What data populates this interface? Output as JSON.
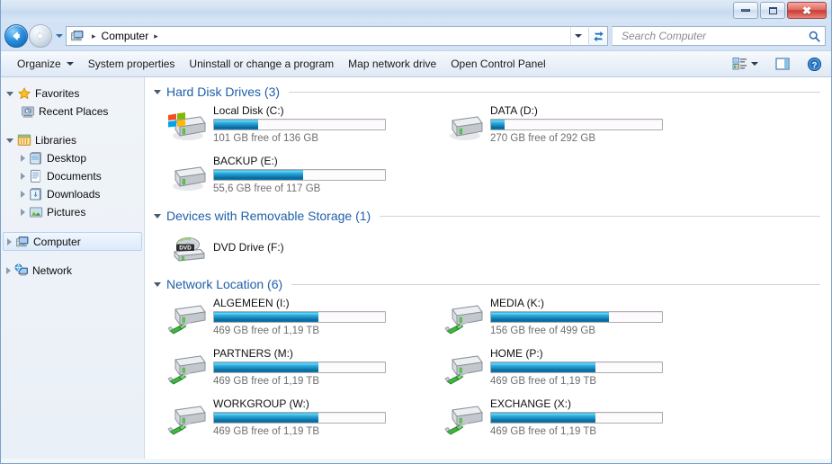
{
  "window": {
    "buttons": {
      "minimize": "Minimize",
      "maximize": "Maximize",
      "close": "✖"
    }
  },
  "navigation": {
    "back_label": "Back",
    "forward_label": "Forward",
    "history_label": "Recent pages",
    "refresh_label": "Refresh",
    "breadcrumb": {
      "icon": "computer-icon",
      "items": [
        "Computer"
      ],
      "separator": "▸"
    }
  },
  "search": {
    "placeholder": "Search Computer",
    "value": "",
    "icon": "search-icon"
  },
  "toolbar": {
    "organize": "Organize",
    "system_properties": "System properties",
    "uninstall": "Uninstall or change a program",
    "map_network_drive": "Map network drive",
    "open_control_panel": "Open Control Panel",
    "change_view_label": "Change your view",
    "preview_pane_label": "Show the preview pane",
    "help_label": "Get help",
    "help_glyph": "?"
  },
  "sidebar": {
    "groups": [
      {
        "label": "Favorites",
        "icon": "star-icon",
        "expanded": true,
        "children": [
          {
            "label": "Recent Places",
            "icon": "recent-places-icon",
            "expandable": false
          }
        ]
      },
      {
        "label": "Libraries",
        "icon": "libraries-icon",
        "expanded": true,
        "children": [
          {
            "label": "Desktop",
            "icon": "desktop-library-icon",
            "expandable": true
          },
          {
            "label": "Documents",
            "icon": "documents-library-icon",
            "expandable": true
          },
          {
            "label": "Downloads",
            "icon": "downloads-library-icon",
            "expandable": true
          },
          {
            "label": "Pictures",
            "icon": "pictures-library-icon",
            "expandable": true
          }
        ]
      },
      {
        "label": "Computer",
        "icon": "computer-icon",
        "expandable": true,
        "selected": true,
        "children": []
      },
      {
        "label": "Network",
        "icon": "network-icon",
        "expandable": true,
        "children": []
      }
    ]
  },
  "content": {
    "groups": [
      {
        "title": "Hard Disk Drives (3)",
        "name": "hard-disk-drives",
        "expanded": true,
        "items": [
          {
            "name": "Local Disk (C:)",
            "icon": "windows-hard-drive-icon",
            "has_bar": true,
            "used_percent": 26,
            "capacity_text": "101 GB free of 136 GB"
          },
          {
            "name": "DATA (D:)",
            "icon": "hard-drive-icon",
            "has_bar": true,
            "used_percent": 8,
            "capacity_text": "270 GB free of 292 GB"
          },
          {
            "name": "BACKUP (E:)",
            "icon": "hard-drive-icon",
            "has_bar": true,
            "used_percent": 52,
            "capacity_text": "55,6 GB free of 117 GB"
          }
        ]
      },
      {
        "title": "Devices with Removable Storage (1)",
        "name": "removable-storage",
        "expanded": true,
        "items": [
          {
            "name": "DVD Drive (F:)",
            "icon": "dvd-drive-icon",
            "has_bar": false,
            "used_percent": 0,
            "capacity_text": ""
          }
        ]
      },
      {
        "title": "Network Location (6)",
        "name": "network-location",
        "expanded": true,
        "items": [
          {
            "name": "ALGEMEEN (I:)",
            "icon": "network-drive-icon",
            "has_bar": true,
            "used_percent": 61,
            "capacity_text": "469 GB free of 1,19 TB"
          },
          {
            "name": "MEDIA (K:)",
            "icon": "network-drive-icon",
            "has_bar": true,
            "used_percent": 69,
            "capacity_text": "156 GB free of 499 GB"
          },
          {
            "name": "PARTNERS (M:)",
            "icon": "network-drive-icon",
            "has_bar": true,
            "used_percent": 61,
            "capacity_text": "469 GB free of 1,19 TB"
          },
          {
            "name": "HOME (P:)",
            "icon": "network-drive-icon",
            "has_bar": true,
            "used_percent": 61,
            "capacity_text": "469 GB free of 1,19 TB"
          },
          {
            "name": "WORKGROUP (W:)",
            "icon": "network-drive-icon",
            "has_bar": true,
            "used_percent": 61,
            "capacity_text": "469 GB free of 1,19 TB"
          },
          {
            "name": "EXCHANGE (X:)",
            "icon": "network-drive-icon",
            "has_bar": true,
            "used_percent": 61,
            "capacity_text": "469 GB free of 1,19 TB"
          }
        ]
      }
    ]
  },
  "colors": {
    "group_header": "#1f5fa9",
    "bar_fill_light": "#6fd6f5",
    "bar_fill_dark": "#0b6799",
    "selection": "#dceafa",
    "close_button": "#c93b33"
  }
}
